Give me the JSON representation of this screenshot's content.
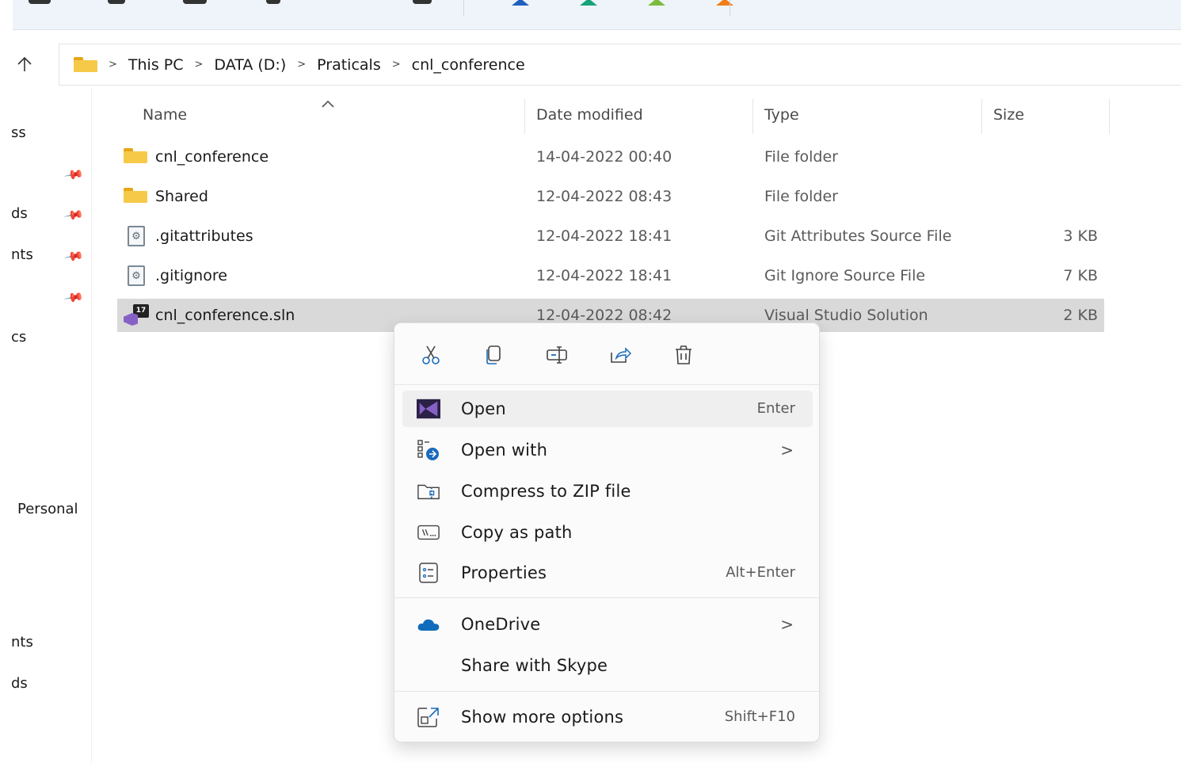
{
  "breadcrumb": {
    "items": [
      "This PC",
      "DATA (D:)",
      "Praticals",
      "cnl_conference"
    ]
  },
  "nav_pane": {
    "fragments": [
      "ss",
      "ds",
      "nts",
      "cs",
      "Personal",
      "nts",
      "ds"
    ]
  },
  "columns": {
    "name": "Name",
    "date": "Date modified",
    "type": "Type",
    "size": "Size"
  },
  "files": [
    {
      "name": "cnl_conference",
      "date": "14-04-2022 00:40",
      "type": "File folder",
      "size": "",
      "icon": "folder-icon"
    },
    {
      "name": "Shared",
      "date": "12-04-2022 08:43",
      "type": "File folder",
      "size": "",
      "icon": "folder-icon"
    },
    {
      "name": ".gitattributes",
      "date": "12-04-2022 18:41",
      "type": "Git Attributes Source File",
      "size": "3 KB",
      "icon": "settings-file-icon"
    },
    {
      "name": ".gitignore",
      "date": "12-04-2022 18:41",
      "type": "Git Ignore Source File",
      "size": "7 KB",
      "icon": "settings-file-icon"
    },
    {
      "name": "cnl_conference.sln",
      "date": "12-04-2022 08:42",
      "type": "Visual Studio Solution",
      "size": "2 KB",
      "icon": "visual-studio-solution-icon",
      "selected": true
    }
  ],
  "sln_badge": "17",
  "context_menu": {
    "quick_actions": [
      "cut-icon",
      "copy-icon",
      "rename-icon",
      "share-icon",
      "delete-icon"
    ],
    "items": [
      {
        "label": "Open",
        "shortcut": "Enter",
        "icon": "visual-studio-icon"
      },
      {
        "label": "Open with",
        "submenu": ">",
        "icon": "open-with-icon"
      },
      {
        "label": "Compress to ZIP file",
        "icon": "zip-icon"
      },
      {
        "label": "Copy as path",
        "icon": "copy-path-icon"
      },
      {
        "label": "Properties",
        "shortcut": "Alt+Enter",
        "icon": "properties-icon"
      },
      {
        "label": "OneDrive",
        "submenu": ">",
        "icon": "onedrive-icon"
      },
      {
        "label": "Share with Skype",
        "icon": ""
      },
      {
        "label": "Show more options",
        "shortcut": "Shift+F10",
        "icon": "show-more-options-icon"
      }
    ]
  },
  "colors": {
    "selection": "#d9d9d9",
    "folder": "#f7c948",
    "accent": "#0f6cbd",
    "visual_studio": "#8661c5"
  }
}
